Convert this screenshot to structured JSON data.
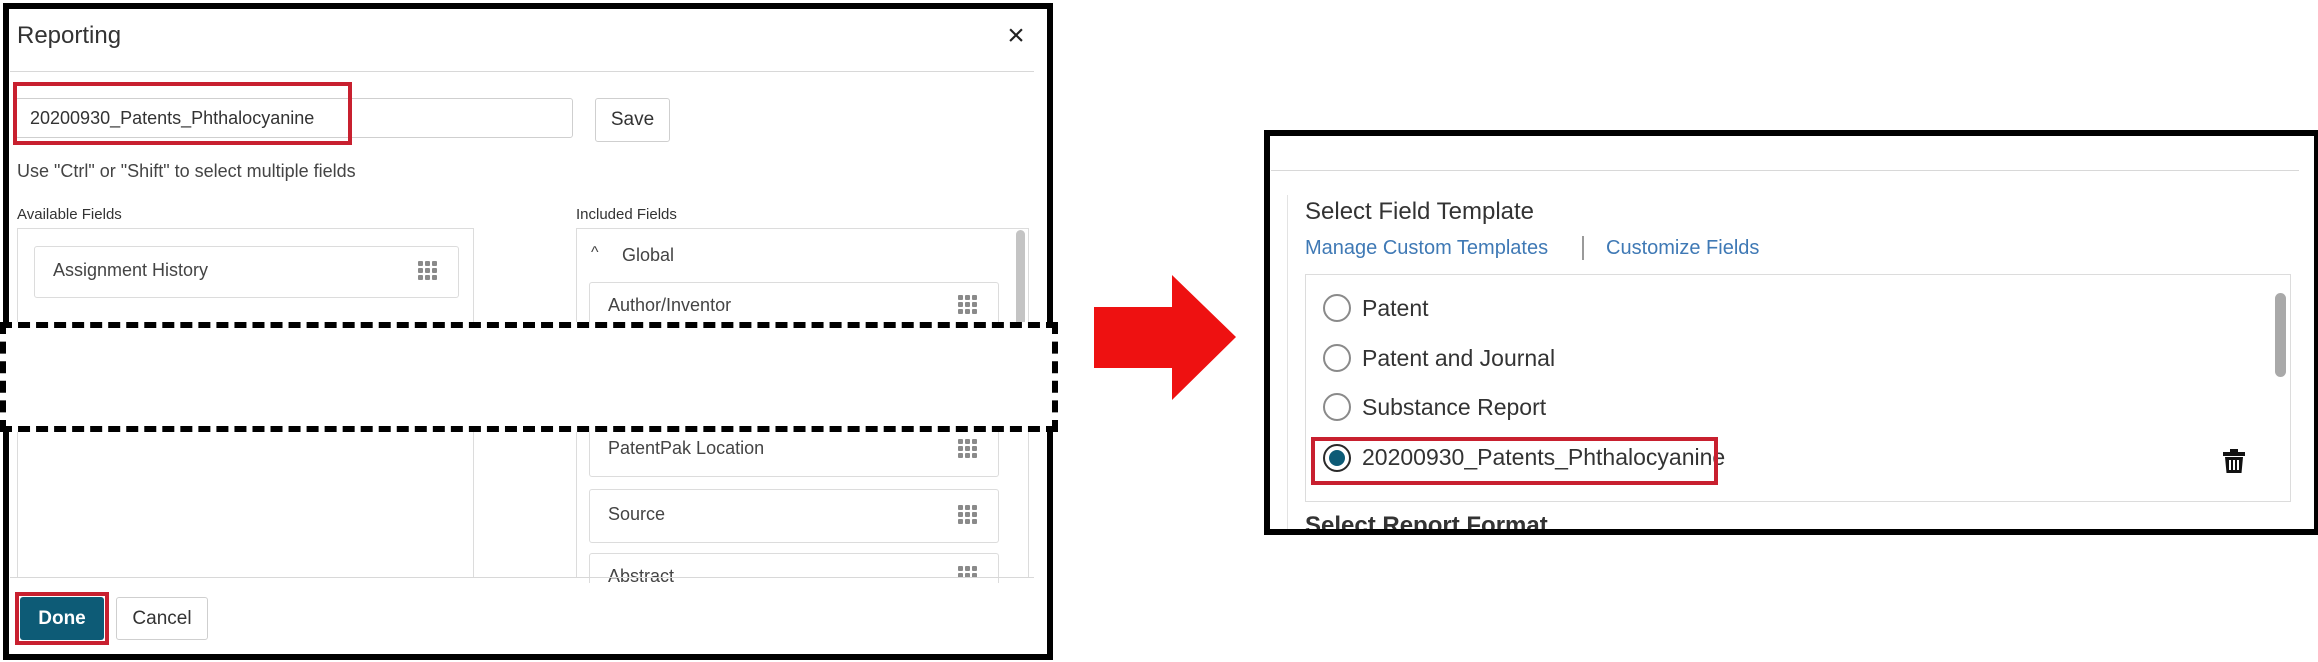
{
  "dialog": {
    "title": "Reporting",
    "close_icon": "close-icon",
    "close_glyph": "×",
    "template_name_value": "20200930_Patents_Phthalocyanine",
    "save_label": "Save",
    "hint": "Use \"Ctrl\" or \"Shift\" to select multiple fields",
    "available_fields": {
      "label": "Available Fields",
      "items": [
        {
          "label": "Assignment History",
          "icon": "drag-handle-icon"
        }
      ]
    },
    "included_fields": {
      "label": "Included Fields",
      "group": {
        "label": "Global",
        "expanded": true,
        "chevron_glyph": "^"
      },
      "items": [
        {
          "label": "Author/Inventor",
          "icon": "drag-handle-icon"
        },
        {
          "label": "PatentPak Location",
          "icon": "drag-handle-icon"
        },
        {
          "label": "Source",
          "icon": "drag-handle-icon"
        },
        {
          "label": "Abstract",
          "icon": "drag-handle-icon"
        }
      ]
    },
    "done_label": "Done",
    "cancel_label": "Cancel"
  },
  "arrow": {
    "icon": "right-arrow-icon",
    "color": "#ee1111"
  },
  "template_panel": {
    "title": "Select Field Template",
    "manage_link": "Manage Custom Templates",
    "separator": "|",
    "customize_link": "Customize Fields",
    "templates": [
      {
        "label": "Patent",
        "selected": false
      },
      {
        "label": "Patent and Journal",
        "selected": false
      },
      {
        "label": "Substance Report",
        "selected": false
      },
      {
        "label": "20200930_Patents_Phthalocyanine",
        "selected": true,
        "deletable": true
      }
    ],
    "next_section_title": "Select Report Format"
  },
  "colors": {
    "primary": "#0d5b76",
    "highlight": "#c8202f",
    "link": "#3f79b5",
    "arrow": "#ee1111"
  }
}
